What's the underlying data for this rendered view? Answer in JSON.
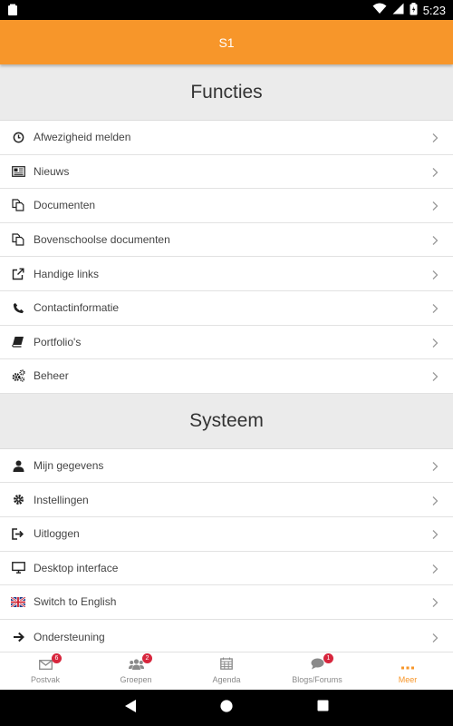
{
  "status_bar": {
    "time": "5:23",
    "icons": [
      "notification-icon",
      "wifi-icon",
      "signal-icon",
      "battery-icon"
    ]
  },
  "app_bar": {
    "title": "S1",
    "color": "#f7962a"
  },
  "sections": [
    {
      "title": "Functies",
      "items": [
        {
          "label": "Afwezigheid melden",
          "icon": "clock-icon"
        },
        {
          "label": "Nieuws",
          "icon": "newspaper-icon"
        },
        {
          "label": "Documenten",
          "icon": "documents-icon"
        },
        {
          "label": "Bovenschoolse documenten",
          "icon": "documents-icon"
        },
        {
          "label": "Handige links",
          "icon": "external-link-icon"
        },
        {
          "label": "Contactinformatie",
          "icon": "phone-icon"
        },
        {
          "label": "Portfolio's",
          "icon": "book-icon"
        },
        {
          "label": "Beheer",
          "icon": "cogs-icon"
        }
      ]
    },
    {
      "title": "Systeem",
      "items": [
        {
          "label": "Mijn gegevens",
          "icon": "user-icon"
        },
        {
          "label": "Instellingen",
          "icon": "gear-icon"
        },
        {
          "label": "Uitloggen",
          "icon": "logout-icon"
        },
        {
          "label": "Desktop interface",
          "icon": "desktop-icon"
        },
        {
          "label": "Switch to English",
          "icon": "uk-flag-icon"
        },
        {
          "label": "Ondersteuning",
          "icon": "arrow-right-icon"
        }
      ]
    }
  ],
  "bottom_nav": [
    {
      "label": "Postvak",
      "icon": "envelope-icon",
      "badge": "6"
    },
    {
      "label": "Groepen",
      "icon": "group-icon",
      "badge": "2"
    },
    {
      "label": "Agenda",
      "icon": "calendar-icon",
      "badge": ""
    },
    {
      "label": "Blogs/Forums",
      "icon": "comment-icon",
      "badge": "1"
    },
    {
      "label": "Meer",
      "icon": "more-icon",
      "badge": "",
      "active": true
    }
  ],
  "colors": {
    "accent": "#f7962a",
    "badge": "#d7263d",
    "section_bg": "#ebebeb"
  }
}
